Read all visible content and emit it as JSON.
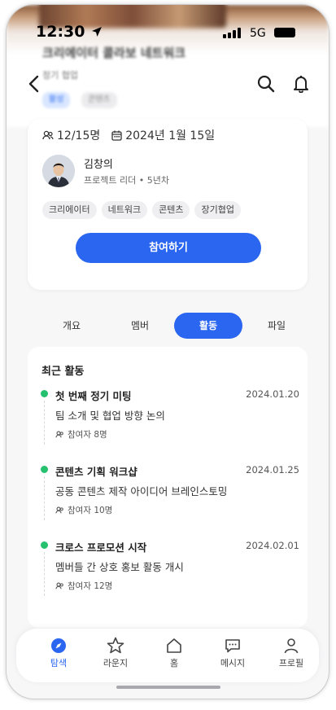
{
  "status_bar": {
    "time": "12:30",
    "network": "5G"
  },
  "hero": {
    "title": "크리에이터 콜라보 네트워크",
    "subtitle": "정기 협업",
    "chips": [
      "활성",
      "콘텐츠"
    ]
  },
  "icons": {
    "back": "chevron-left-icon",
    "search": "search-icon",
    "bell": "bell-icon"
  },
  "summary": {
    "members": "12/15명",
    "date": "2024년 1월 15일",
    "leader_name": "김창의",
    "leader_role": "프로젝트 리더 • 5년차",
    "tags": [
      "크리에이터",
      "네트워크",
      "콘텐츠",
      "장기협업"
    ],
    "join_label": "참여하기"
  },
  "tabs": [
    {
      "label": "개요",
      "active": false
    },
    {
      "label": "멤버",
      "active": false
    },
    {
      "label": "활동",
      "active": true
    },
    {
      "label": "파일",
      "active": false
    }
  ],
  "activity": {
    "heading": "최근 활동",
    "items": [
      {
        "title": "첫 번째 정기 미팅",
        "date": "2024.01.20",
        "desc": "팀 소개 및 협업 방향 논의",
        "count": "참여자 8명"
      },
      {
        "title": "콘텐츠 기획 워크샵",
        "date": "2024.01.25",
        "desc": "공동 콘텐츠 제작 아이디어 브레인스토밍",
        "count": "참여자 10명"
      },
      {
        "title": "크로스 프로모션 시작",
        "date": "2024.02.01",
        "desc": "멤버들 간 상호 홍보 활동 개시",
        "count": "참여자 12명"
      }
    ]
  },
  "bottom_nav": [
    {
      "label": "탐색",
      "icon": "compass-icon",
      "active": true
    },
    {
      "label": "라운지",
      "icon": "star-icon",
      "active": false
    },
    {
      "label": "홈",
      "icon": "home-icon",
      "active": false
    },
    {
      "label": "메시지",
      "icon": "message-icon",
      "active": false
    },
    {
      "label": "프로필",
      "icon": "user-icon",
      "active": false
    }
  ],
  "colors": {
    "accent": "#2a66f0",
    "dot": "#25c16f"
  }
}
